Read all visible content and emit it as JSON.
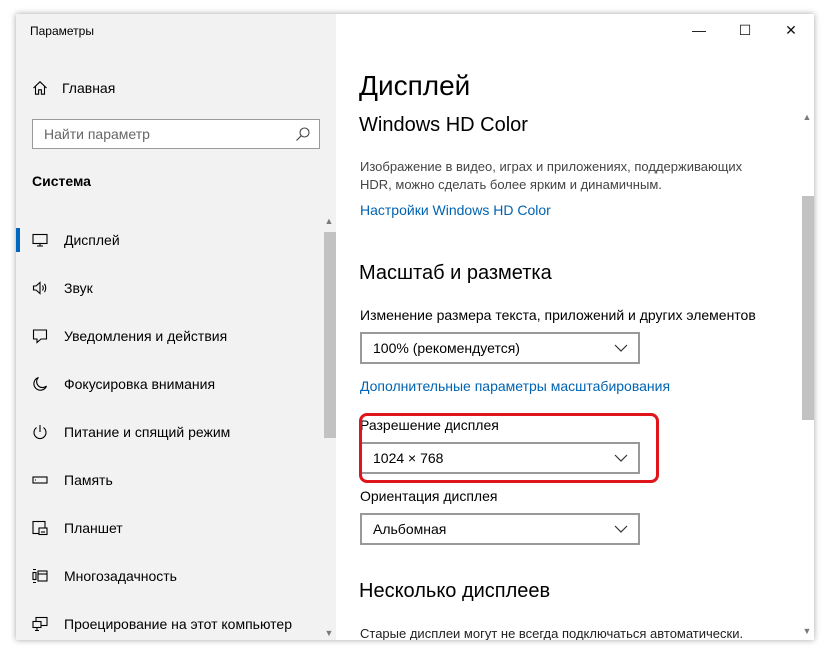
{
  "window": {
    "title": "Параметры"
  },
  "titlebar": {
    "minimize": "—",
    "maximize": "☐",
    "close": "✕"
  },
  "sidebar": {
    "home_label": "Главная",
    "search_placeholder": "Найти параметр",
    "section_title": "Система",
    "items": [
      {
        "label": "Дисплей",
        "icon": "monitor-icon",
        "active": true
      },
      {
        "label": "Звук",
        "icon": "speaker-icon"
      },
      {
        "label": "Уведомления и действия",
        "icon": "notification-icon"
      },
      {
        "label": "Фокусировка внимания",
        "icon": "moon-icon"
      },
      {
        "label": "Питание и спящий режим",
        "icon": "power-icon"
      },
      {
        "label": "Память",
        "icon": "storage-icon"
      },
      {
        "label": "Планшет",
        "icon": "tablet-icon"
      },
      {
        "label": "Многозадачность",
        "icon": "multitasking-icon"
      },
      {
        "label": "Проецирование на этот компьютер",
        "icon": "projecting-icon"
      }
    ]
  },
  "main": {
    "page_title": "Дисплей",
    "hdr": {
      "heading": "Windows HD Color",
      "description_line1": "Изображение в видео, играх и приложениях, поддерживающих",
      "description_line2": "HDR, можно сделать более ярким и динамичным.",
      "link": "Настройки Windows HD Color"
    },
    "scale_layout": {
      "heading": "Масштаб и разметка",
      "scale_label": "Изменение размера текста, приложений и других элементов",
      "scale_value": "100% (рекомендуется)",
      "advanced_link": "Дополнительные параметры масштабирования",
      "resolution_label": "Разрешение дисплея",
      "resolution_value": "1024 × 768",
      "orientation_label": "Ориентация дисплея",
      "orientation_value": "Альбомная"
    },
    "multiple_displays": {
      "heading": "Несколько дисплеев",
      "description": "Старые дисплеи могут не всегда подключаться автоматически."
    }
  },
  "colors": {
    "accent": "#0067c0",
    "link": "#0063b1",
    "highlight": "#e0151c",
    "sidebar_bg": "#f2f2f2"
  }
}
